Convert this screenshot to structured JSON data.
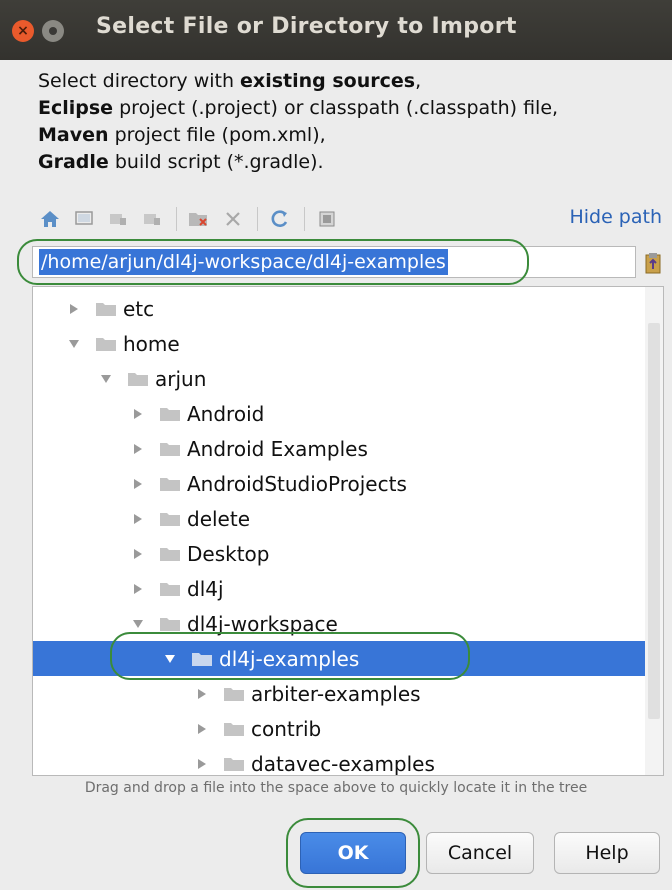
{
  "window": {
    "title": "Select File or Directory to Import"
  },
  "description": {
    "line1_prefix": "Select directory with ",
    "line1_bold": "existing sources",
    "line1_suffix": ",",
    "line2_bold": "Eclipse",
    "line2_rest": " project (.project) or classpath (.classpath) file,",
    "line3_bold": "Maven",
    "line3_rest": " project file (pom.xml),",
    "line4_bold": "Gradle",
    "line4_rest": " build script (*.gradle)."
  },
  "toolbar": {
    "hide_path_label": "Hide path"
  },
  "path": {
    "value": "/home/arjun/dl4j-workspace/dl4j-examples"
  },
  "tree": {
    "rows": [
      {
        "label": "etc",
        "depth": 0,
        "expanded": false,
        "selected": false
      },
      {
        "label": "home",
        "depth": 0,
        "expanded": true,
        "selected": false
      },
      {
        "label": "arjun",
        "depth": 1,
        "expanded": true,
        "selected": false
      },
      {
        "label": "Android",
        "depth": 2,
        "expanded": false,
        "selected": false
      },
      {
        "label": "Android Examples",
        "depth": 2,
        "expanded": false,
        "selected": false
      },
      {
        "label": "AndroidStudioProjects",
        "depth": 2,
        "expanded": false,
        "selected": false
      },
      {
        "label": "delete",
        "depth": 2,
        "expanded": false,
        "selected": false
      },
      {
        "label": "Desktop",
        "depth": 2,
        "expanded": false,
        "selected": false
      },
      {
        "label": "dl4j",
        "depth": 2,
        "expanded": false,
        "selected": false
      },
      {
        "label": "dl4j-workspace",
        "depth": 2,
        "expanded": true,
        "selected": false
      },
      {
        "label": "dl4j-examples",
        "depth": 3,
        "expanded": true,
        "selected": true
      },
      {
        "label": "arbiter-examples",
        "depth": 4,
        "expanded": false,
        "selected": false
      },
      {
        "label": "contrib",
        "depth": 4,
        "expanded": false,
        "selected": false
      },
      {
        "label": "datavec-examples",
        "depth": 4,
        "expanded": false,
        "selected": false
      }
    ]
  },
  "hint": "Drag and drop a file into the space above to quickly locate it in the tree",
  "buttons": {
    "ok": "OK",
    "cancel": "Cancel",
    "help": "Help"
  },
  "colors": {
    "selection": "#3875d7",
    "annotation_ring": "#3b8b3b",
    "link": "#2a62b6"
  }
}
